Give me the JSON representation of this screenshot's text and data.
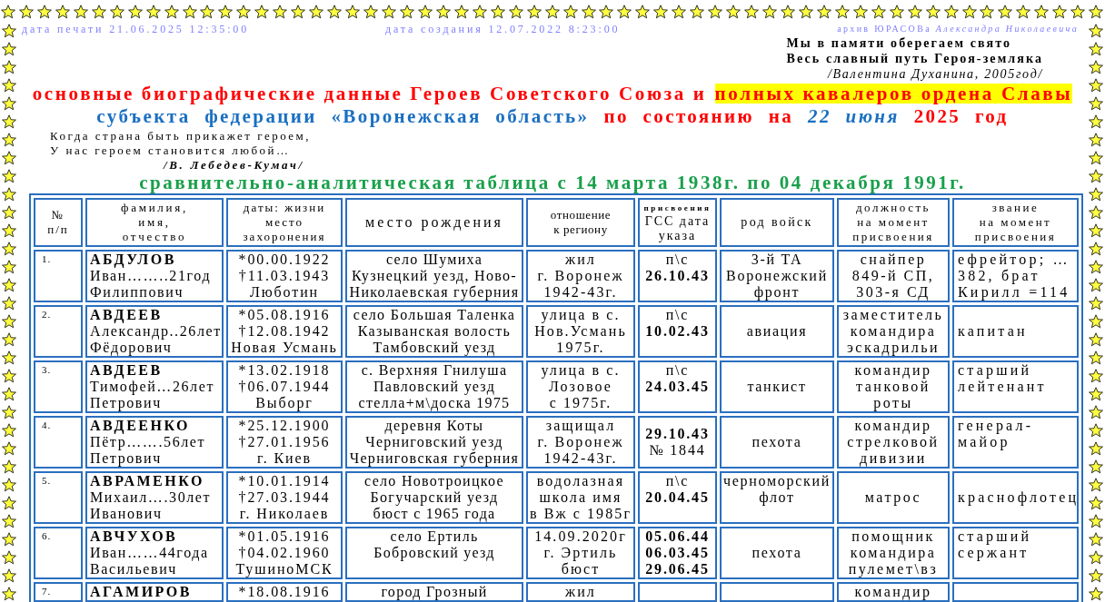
{
  "header": {
    "print_date": "дата печати 21.06.2025 12:35:00",
    "created_date": "дата создания 12.07.2022 8:23:00",
    "archive": "архив ЮРАСОВа *Александра Николаевича*"
  },
  "epigraph_top": {
    "lines": [
      "Мы в памяти оберегаем свято",
      "Весь славный путь Героя-земляка"
    ],
    "author": "/Валентина Духанина, 2005год/"
  },
  "title": {
    "lines": [
      [
        {
          "text": "основные биографические данные Героев Советского Союза и",
          "kind": "label",
          "highlighted": false
        },
        {
          "text": "полных кавалеров ордена Славы",
          "kind": "label",
          "highlighted": true
        }
      ],
      [
        {
          "text": "субъекта федерации «Воронежская область»",
          "kind": "region",
          "highlighted": false
        },
        {
          "text": "по состоянию на",
          "kind": "label",
          "highlighted": false
        },
        {
          "text": "22 июня",
          "kind": "date",
          "highlighted": false
        },
        {
          "text": "2025 год",
          "kind": "label",
          "highlighted": false
        }
      ]
    ]
  },
  "epigraph_bottom": {
    "lines": [
      "Когда страна быть прикажет героем,",
      "У нас героем становится любой…"
    ],
    "author": "/В. Лебедев-Кумач/"
  },
  "subtitle": "сравнительно-аналитическая таблица с 14 марта 1938г. по 04 декабря 1991г.",
  "table": {
    "columns": [
      {
        "lines": [
          "№",
          "п/п"
        ]
      },
      {
        "lines": [
          "фамилия,",
          "имя,",
          "отчество"
        ]
      },
      {
        "lines": [
          "даты: жизни",
          "место",
          "захоронения"
        ]
      },
      {
        "lines": [
          "место рождения"
        ]
      },
      {
        "lines": [
          "отношение",
          "к региону"
        ]
      },
      {
        "lines": [
          "присвоения",
          "ГСС дата",
          "указа"
        ]
      },
      {
        "lines": [
          "род войск"
        ]
      },
      {
        "lines": [
          "должность",
          "на момент",
          "присвоения"
        ]
      },
      {
        "lines": [
          "звание",
          "на момент",
          "присвоения"
        ]
      }
    ],
    "rows": [
      {
        "number": "1.",
        "surname": "АБДУЛОВ",
        "given_name": "Иван……..21год",
        "patronymic": "Филиппович",
        "life_dates": [
          "*00.00.1922",
          "†11.03.1943",
          "Люботин"
        ],
        "birthplace": [
          "село Шумиха",
          "Кузнецкий уезд, Ново-",
          "Николаевская губерния"
        ],
        "region_relation": [
          "жил",
          "г. Воронеж",
          "1942-43г."
        ],
        "award": {
          "note": "п\\с",
          "dates": [
            "26.10.43"
          ]
        },
        "service_branch": [
          "3-й ТА",
          "Воронежский",
          "фронт"
        ],
        "position": [
          "снайпер",
          "849-й СП,",
          "303-я СД"
        ],
        "rank": [
          "ефрейтор; …",
          "382, брат",
          "Кирилл =114"
        ]
      },
      {
        "number": "2.",
        "surname": "АВДЕЕВ",
        "given_name": "Александр..26лет",
        "patronymic": "Фёдорович",
        "life_dates": [
          "*05.08.1916",
          "†12.08.1942",
          "Новая Усмань"
        ],
        "birthplace": [
          "село Большая Таленка",
          "Казыванская волость",
          "Тамбовский уезд"
        ],
        "region_relation": [
          "улица в с.",
          "Нов.Усмань",
          "1975г."
        ],
        "award": {
          "note": "п\\с",
          "dates": [
            "10.02.43"
          ]
        },
        "service_branch": [
          "авиация"
        ],
        "position": [
          "заместитель",
          "командира",
          "эскадрильи"
        ],
        "rank": [
          "капитан"
        ]
      },
      {
        "number": "3.",
        "surname": "АВДЕЕВ",
        "given_name": "Тимофей…26лет",
        "patronymic": "Петрович",
        "life_dates": [
          "*13.02.1918",
          "†06.07.1944",
          "Выборг"
        ],
        "birthplace": [
          "с. Верхняя Гнилуша",
          "Павловский уезд",
          "стелла+м\\доска 1975"
        ],
        "region_relation": [
          "улица в с.",
          "Лозовое",
          "с 1975г."
        ],
        "award": {
          "note": "п\\с",
          "dates": [
            "24.03.45"
          ]
        },
        "service_branch": [
          "танкист"
        ],
        "position": [
          "командир",
          "танковой",
          "роты"
        ],
        "rank": [
          "старший",
          "лейтенант"
        ]
      },
      {
        "number": "4.",
        "surname": "АВДЕЕНКО",
        "given_name": "Пётр…….56лет",
        "patronymic": "Петрович",
        "life_dates": [
          "*25.12.1900",
          "†27.01.1956",
          "г. Киев"
        ],
        "birthplace": [
          "деревня Коты",
          "Черниговский уезд",
          "Черниговская губерния"
        ],
        "region_relation": [
          "защищал",
          "г. Воронеж",
          "1942-43г."
        ],
        "award": {
          "dates": [
            "29.10.43"
          ],
          "decree": "№ 1844"
        },
        "service_branch": [
          "пехота"
        ],
        "position": [
          "командир",
          "стрелковой",
          "дивизии"
        ],
        "rank": [
          "генерал-",
          "майор"
        ]
      },
      {
        "number": "5.",
        "surname": "АВРАМЕНКО",
        "given_name": "Михаил….30лет",
        "patronymic": "Иванович",
        "life_dates": [
          "*10.01.1914",
          "†27.03.1944",
          "г. Николаев"
        ],
        "birthplace": [
          "село Новотроицкое",
          "Богучарский уезд",
          "бюст с 1965 года"
        ],
        "region_relation": [
          "водолазная",
          "школа имя",
          "в Вж с 1985г"
        ],
        "award": {
          "note": "п\\с",
          "dates": [
            "20.04.45"
          ]
        },
        "service_branch": [
          "черноморский",
          "флот"
        ],
        "position": [
          "матрос"
        ],
        "rank": [
          "краснофлотец"
        ]
      },
      {
        "number": "6.",
        "surname": "АВЧУХОВ",
        "given_name": "Иван……44года",
        "patronymic": "Васильевич",
        "life_dates": [
          "*01.05.1916",
          "†04.02.1960",
          "ТушиноМСК"
        ],
        "birthplace": [
          "село Ертиль",
          "Бобровский уезд"
        ],
        "region_relation": [
          "14.09.2020г",
          "г. Эртиль",
          "бюст"
        ],
        "award": {
          "dates": [
            "05.06.44",
            "06.03.45",
            "29.06.45"
          ]
        },
        "service_branch": [
          "пехота"
        ],
        "position": [
          "помощник",
          "командира",
          "пулемет\\вз"
        ],
        "rank": [
          "старший",
          "сержант"
        ]
      },
      {
        "number": "7.",
        "surname": "АГАМИРОВ",
        "life_dates": [
          "*18.08.1916"
        ],
        "birthplace": [
          "город Грозный"
        ],
        "region_relation": [
          "жил"
        ],
        "position": [
          "командир"
        ]
      }
    ]
  }
}
